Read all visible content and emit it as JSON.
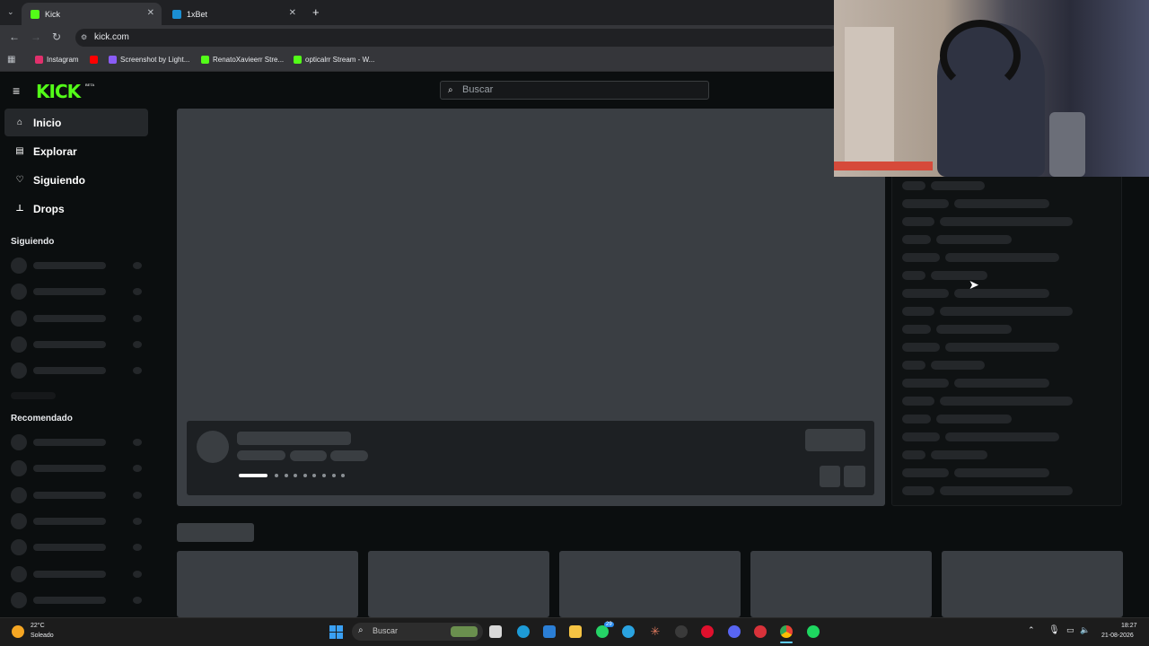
{
  "browser": {
    "tabs": [
      {
        "label": "Kick",
        "active": true,
        "color": "#53fc18"
      },
      {
        "label": "1xBet",
        "active": false,
        "color": "#1b8fd3"
      }
    ],
    "new_tab": "+",
    "url": "kick.com",
    "bookmarks": [
      {
        "label": "Instagram",
        "color": "#e1306c"
      },
      {
        "label": "",
        "color": "#ff0000"
      },
      {
        "label": "Screenshot by Light...",
        "color": "#8a5cf6"
      },
      {
        "label": "RenatoXavieerr Stre...",
        "color": "#53fc18"
      },
      {
        "label": "opticalrr Stream - W...",
        "color": "#53fc18"
      }
    ]
  },
  "kick": {
    "logo": "KICK",
    "beta": "BETA",
    "search_placeholder": "Buscar",
    "nav": [
      {
        "label": "Inicio",
        "icon": "home-icon",
        "active": true
      },
      {
        "label": "Explorar",
        "icon": "explore-icon",
        "active": false
      },
      {
        "label": "Siguiendo",
        "icon": "heart-icon",
        "active": false
      },
      {
        "label": "Drops",
        "icon": "drops-icon",
        "active": false
      }
    ],
    "following_header": "Siguiendo",
    "recommended_header": "Recomendado"
  },
  "taskbar": {
    "weather_temp": "22°C",
    "weather_desc": "Soleado",
    "search_label": "Buscar",
    "time": "18:27",
    "date": "21-08-2026",
    "whatsapp_badge": "29"
  },
  "colors": {
    "accent": "#53fc18",
    "page_bg": "#0b0e0f",
    "skeleton": "#24272a"
  }
}
